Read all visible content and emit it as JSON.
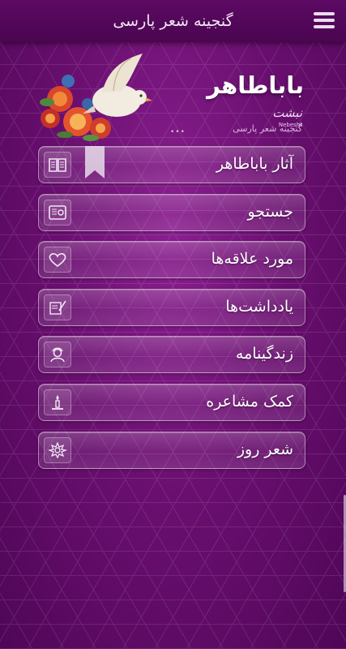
{
  "app": {
    "title": "گنجینه شعر پارسی"
  },
  "header": {
    "poet_name": "باباطاهر",
    "logo_text": "نبشت",
    "logo_sub": "Nebesht",
    "subtitle": "گنجینه شعر پارسی",
    "dots": "•••"
  },
  "menu": {
    "items": [
      {
        "label": "آثار باباطاهر",
        "icon": "book-icon"
      },
      {
        "label": "جستجو",
        "icon": "search-book-icon"
      },
      {
        "label": "مورد علاقه‌ها",
        "icon": "heart-icon"
      },
      {
        "label": "یادداشت‌ها",
        "icon": "quill-scroll-icon"
      },
      {
        "label": "زندگینامه",
        "icon": "portrait-icon"
      },
      {
        "label": "کمک مشاعره",
        "icon": "candle-icon"
      },
      {
        "label": "شعر روز",
        "icon": "ornament-icon"
      }
    ]
  },
  "colors": {
    "background": "#6a0f70",
    "topbar": "#4f0657"
  }
}
